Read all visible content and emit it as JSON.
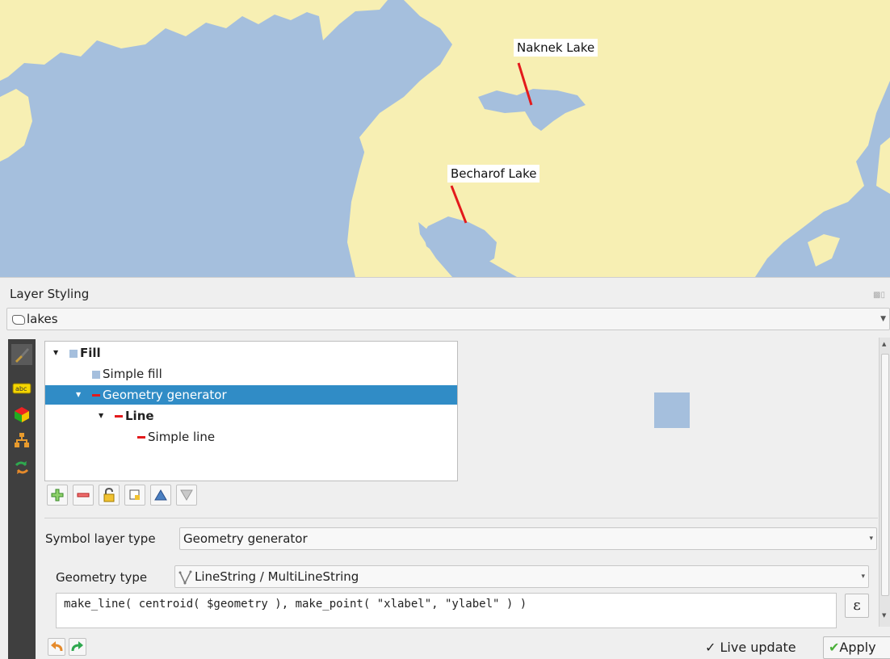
{
  "map": {
    "labels": [
      "Naknek Lake",
      "Becharof Lake"
    ],
    "water_color": "#a5bfdd",
    "land_color": "#f7efb3",
    "leader_color": "#e31a1c"
  },
  "panel": {
    "title": "Layer Styling"
  },
  "layer_selector": {
    "value": "lakes"
  },
  "sidebar": {
    "icons": [
      "paintbrush-icon",
      "abc-label-icon",
      "3d-cube-icon",
      "diagram-icon",
      "history-icon"
    ]
  },
  "symbol_tree": {
    "rows": [
      {
        "label": "Fill",
        "bold": true,
        "icon": "swatch"
      },
      {
        "label": "Simple fill",
        "bold": false,
        "icon": "swatch"
      },
      {
        "label": "Geometry generator",
        "bold": false,
        "icon": "redline",
        "selected": true
      },
      {
        "label": "Line",
        "bold": true,
        "icon": "redline"
      },
      {
        "label": "Simple line",
        "bold": false,
        "icon": "redline"
      }
    ]
  },
  "symbol_toolbar": {
    "buttons": [
      "add-layer",
      "remove-layer",
      "lock-layer",
      "duplicate-layer",
      "move-up",
      "move-down"
    ]
  },
  "symbol_layer_type": {
    "label": "Symbol layer type",
    "value": "Geometry generator"
  },
  "geometry_type": {
    "label": "Geometry type",
    "value": "LineString / MultiLineString"
  },
  "expression": {
    "text": "make_line( centroid( $geometry ), make_point( \"xlabel\", \"ylabel\" ) )",
    "epsilon_label": "ε"
  },
  "bottom_bar": {
    "live_update_label": "Live update",
    "live_update_checked": true,
    "apply_label": "Apply"
  }
}
